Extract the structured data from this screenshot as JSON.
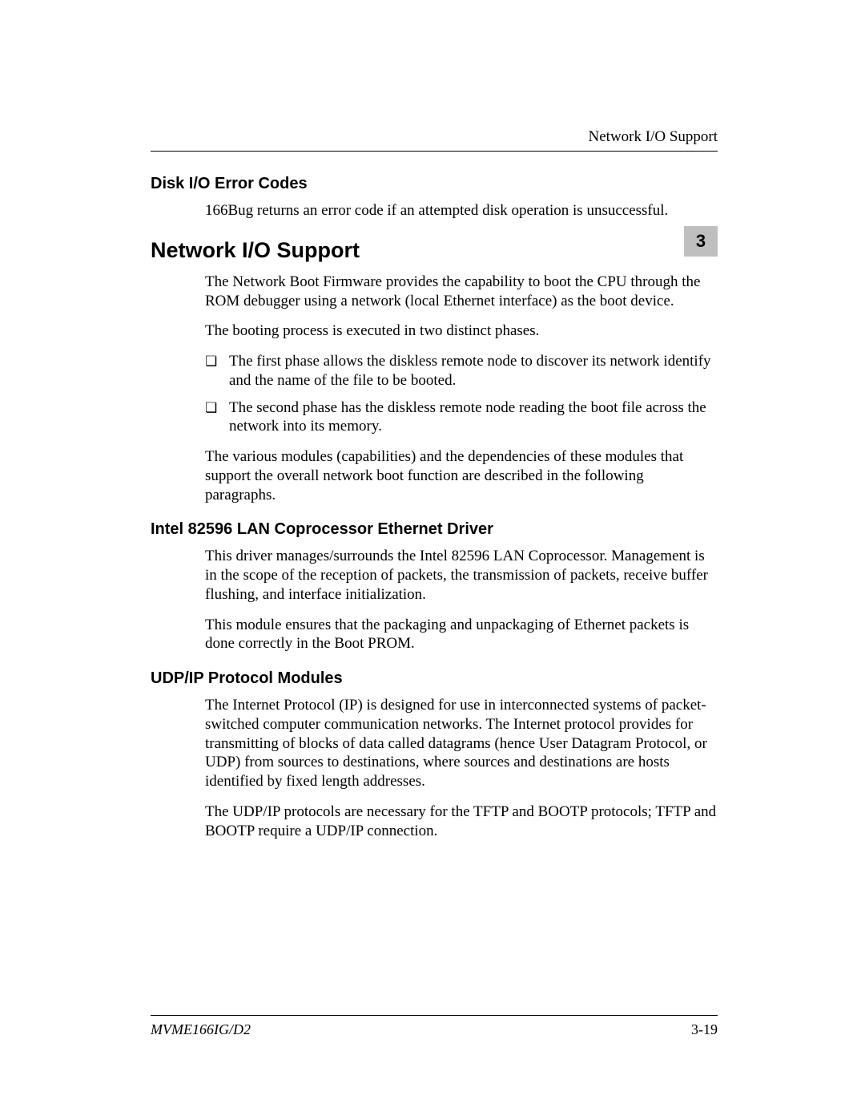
{
  "header": {
    "running_head": "Network I/O Support"
  },
  "chapter_tab": "3",
  "sec1": {
    "heading": "Disk I/O Error Codes",
    "p1": "166Bug returns an error code if an attempted disk operation is unsuccessful."
  },
  "sec2": {
    "heading": "Network I/O Support",
    "p1": "The Network Boot Firmware provides the capability to boot the CPU through the ROM debugger using a network (local Ethernet interface) as the boot device.",
    "p2": "The booting process is executed in two distinct phases.",
    "bullets": [
      "The first phase allows the diskless remote node to discover its network identify and the name of the file to be booted.",
      "The second phase has the diskless remote node reading the boot file across the network into its memory."
    ],
    "p3": "The various modules (capabilities) and the dependencies of these modules that support the overall network boot function are described in the following paragraphs."
  },
  "sec3": {
    "heading": "Intel 82596 LAN Coprocessor Ethernet Driver",
    "p1": "This driver manages/surrounds the Intel 82596 LAN Coprocessor. Management is in the scope of the reception of packets, the transmission of packets, receive buffer flushing, and interface initialization.",
    "p2": "This module ensures that the packaging and unpackaging of Ethernet packets is done correctly in the Boot PROM."
  },
  "sec4": {
    "heading": "UDP/IP Protocol Modules",
    "p1": "The Internet Protocol (IP) is designed for use in interconnected systems of packet-switched computer communication networks. The Internet protocol provides for transmitting of blocks of data called datagrams (hence User Datagram Protocol, or UDP) from sources to destinations, where sources and destinations are hosts identified by fixed length addresses.",
    "p2": "The UDP/IP protocols are necessary for the TFTP and BOOTP protocols; TFTP and BOOTP require a UDP/IP connection."
  },
  "footer": {
    "left": "MVME166IG/D2",
    "right": "3-19"
  }
}
